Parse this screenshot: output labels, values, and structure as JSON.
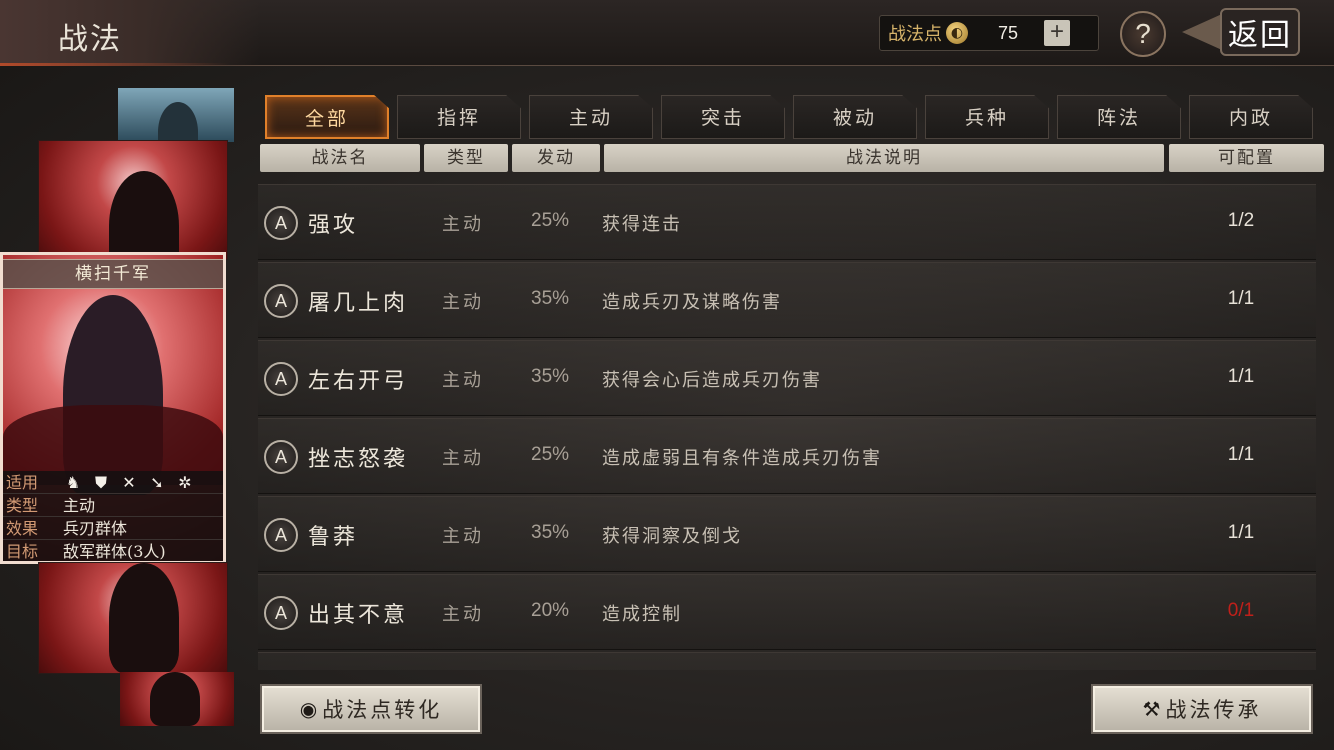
{
  "header": {
    "title": "战法",
    "points_label": "战法点",
    "points_value": "75",
    "plus_label": "+",
    "help_label": "?",
    "back_label": "返回"
  },
  "tabs": [
    {
      "label": "全部",
      "active": true
    },
    {
      "label": "指挥",
      "active": false
    },
    {
      "label": "主动",
      "active": false
    },
    {
      "label": "突击",
      "active": false
    },
    {
      "label": "被动",
      "active": false
    },
    {
      "label": "兵种",
      "active": false
    },
    {
      "label": "阵法",
      "active": false
    },
    {
      "label": "内政",
      "active": false
    }
  ],
  "columns": {
    "name": "战法名",
    "type": "类型",
    "trigger": "发动",
    "desc": "战法说明",
    "config": "可配置"
  },
  "tactics": [
    {
      "grade": "A",
      "name": "强攻",
      "type": "主动",
      "rate": "25%",
      "desc": "获得连击",
      "count": "1/2"
    },
    {
      "grade": "A",
      "name": "屠几上肉",
      "type": "主动",
      "rate": "35%",
      "desc": "造成兵刃及谋略伤害",
      "count": "1/1"
    },
    {
      "grade": "A",
      "name": "左右开弓",
      "type": "主动",
      "rate": "35%",
      "desc": "获得会心后造成兵刃伤害",
      "count": "1/1"
    },
    {
      "grade": "A",
      "name": "挫志怒袭",
      "type": "主动",
      "rate": "25%",
      "desc": "造成虚弱且有条件造成兵刃伤害",
      "count": "1/1"
    },
    {
      "grade": "A",
      "name": "鲁莽",
      "type": "主动",
      "rate": "35%",
      "desc": "获得洞察及倒戈",
      "count": "1/1"
    },
    {
      "grade": "A",
      "name": "出其不意",
      "type": "主动",
      "rate": "20%",
      "desc": "造成控制",
      "count": "0/1"
    }
  ],
  "card": {
    "name": "横扫千军",
    "rows": [
      {
        "key": "适用",
        "value": ""
      },
      {
        "key": "类型",
        "value": "主动"
      },
      {
        "key": "效果",
        "value": "兵刃群体"
      },
      {
        "key": "目标",
        "value": "敌军群体(3人)"
      }
    ],
    "unit_icons": [
      "cavalry-icon",
      "shield-icon",
      "crossbow-icon",
      "spear-icon",
      "wheel-icon"
    ]
  },
  "buttons": {
    "convert": "战法点转化",
    "inherit": "战法传承"
  }
}
